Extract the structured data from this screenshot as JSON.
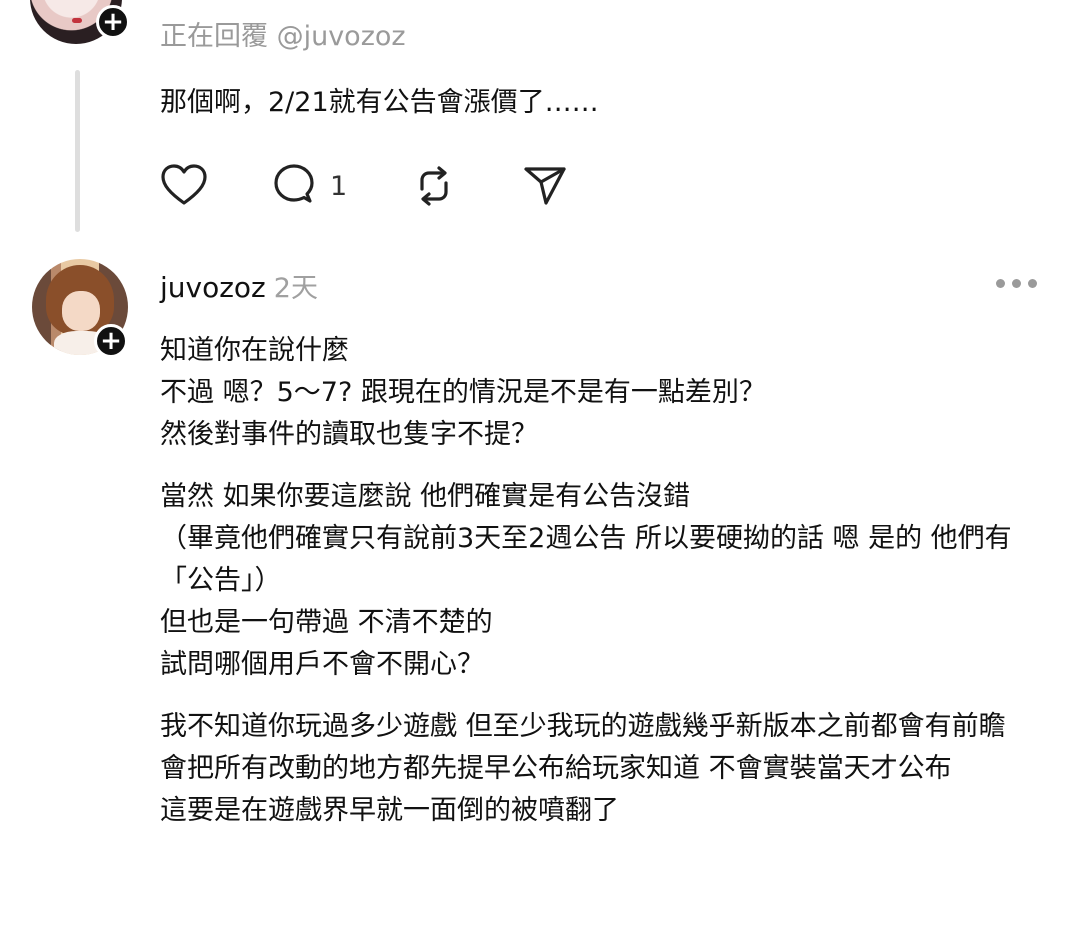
{
  "parent_post": {
    "replying_to": "正在回覆 @juvozoz",
    "text": "那個啊，2/21就有公告會漲價了……",
    "reply_count": "1"
  },
  "post": {
    "username": "juvozoz",
    "time": "2天",
    "paragraphs": [
      {
        "lines": [
          "知道你在說什麼",
          "不過 嗯？5〜7? 跟現在的情況是不是有一點差別？",
          "然後對事件的讀取也隻字不提？"
        ]
      },
      {
        "lines": [
          "當然 如果你要這麼說 他們確實是有公告沒錯",
          "（畢竟他們確實只有說前3天至2週公告 所以要硬拗的話 嗯 是的 他們有「公告」）",
          "但也是一句帶過 不清不楚的",
          "試問哪個用戶不會不開心？"
        ]
      },
      {
        "lines": [
          "我不知道你玩過多少遊戲 但至少我玩的遊戲幾乎新版本之前都會有前瞻",
          "會把所有改動的地方都先提早公布給玩家知道 不會實裝當天才公布",
          "這要是在遊戲界早就一面倒的被噴翻了"
        ]
      }
    ]
  },
  "icons": [
    "heart-icon",
    "comment-icon",
    "repost-icon",
    "share-icon",
    "more-icon",
    "follow-plus-icon"
  ]
}
